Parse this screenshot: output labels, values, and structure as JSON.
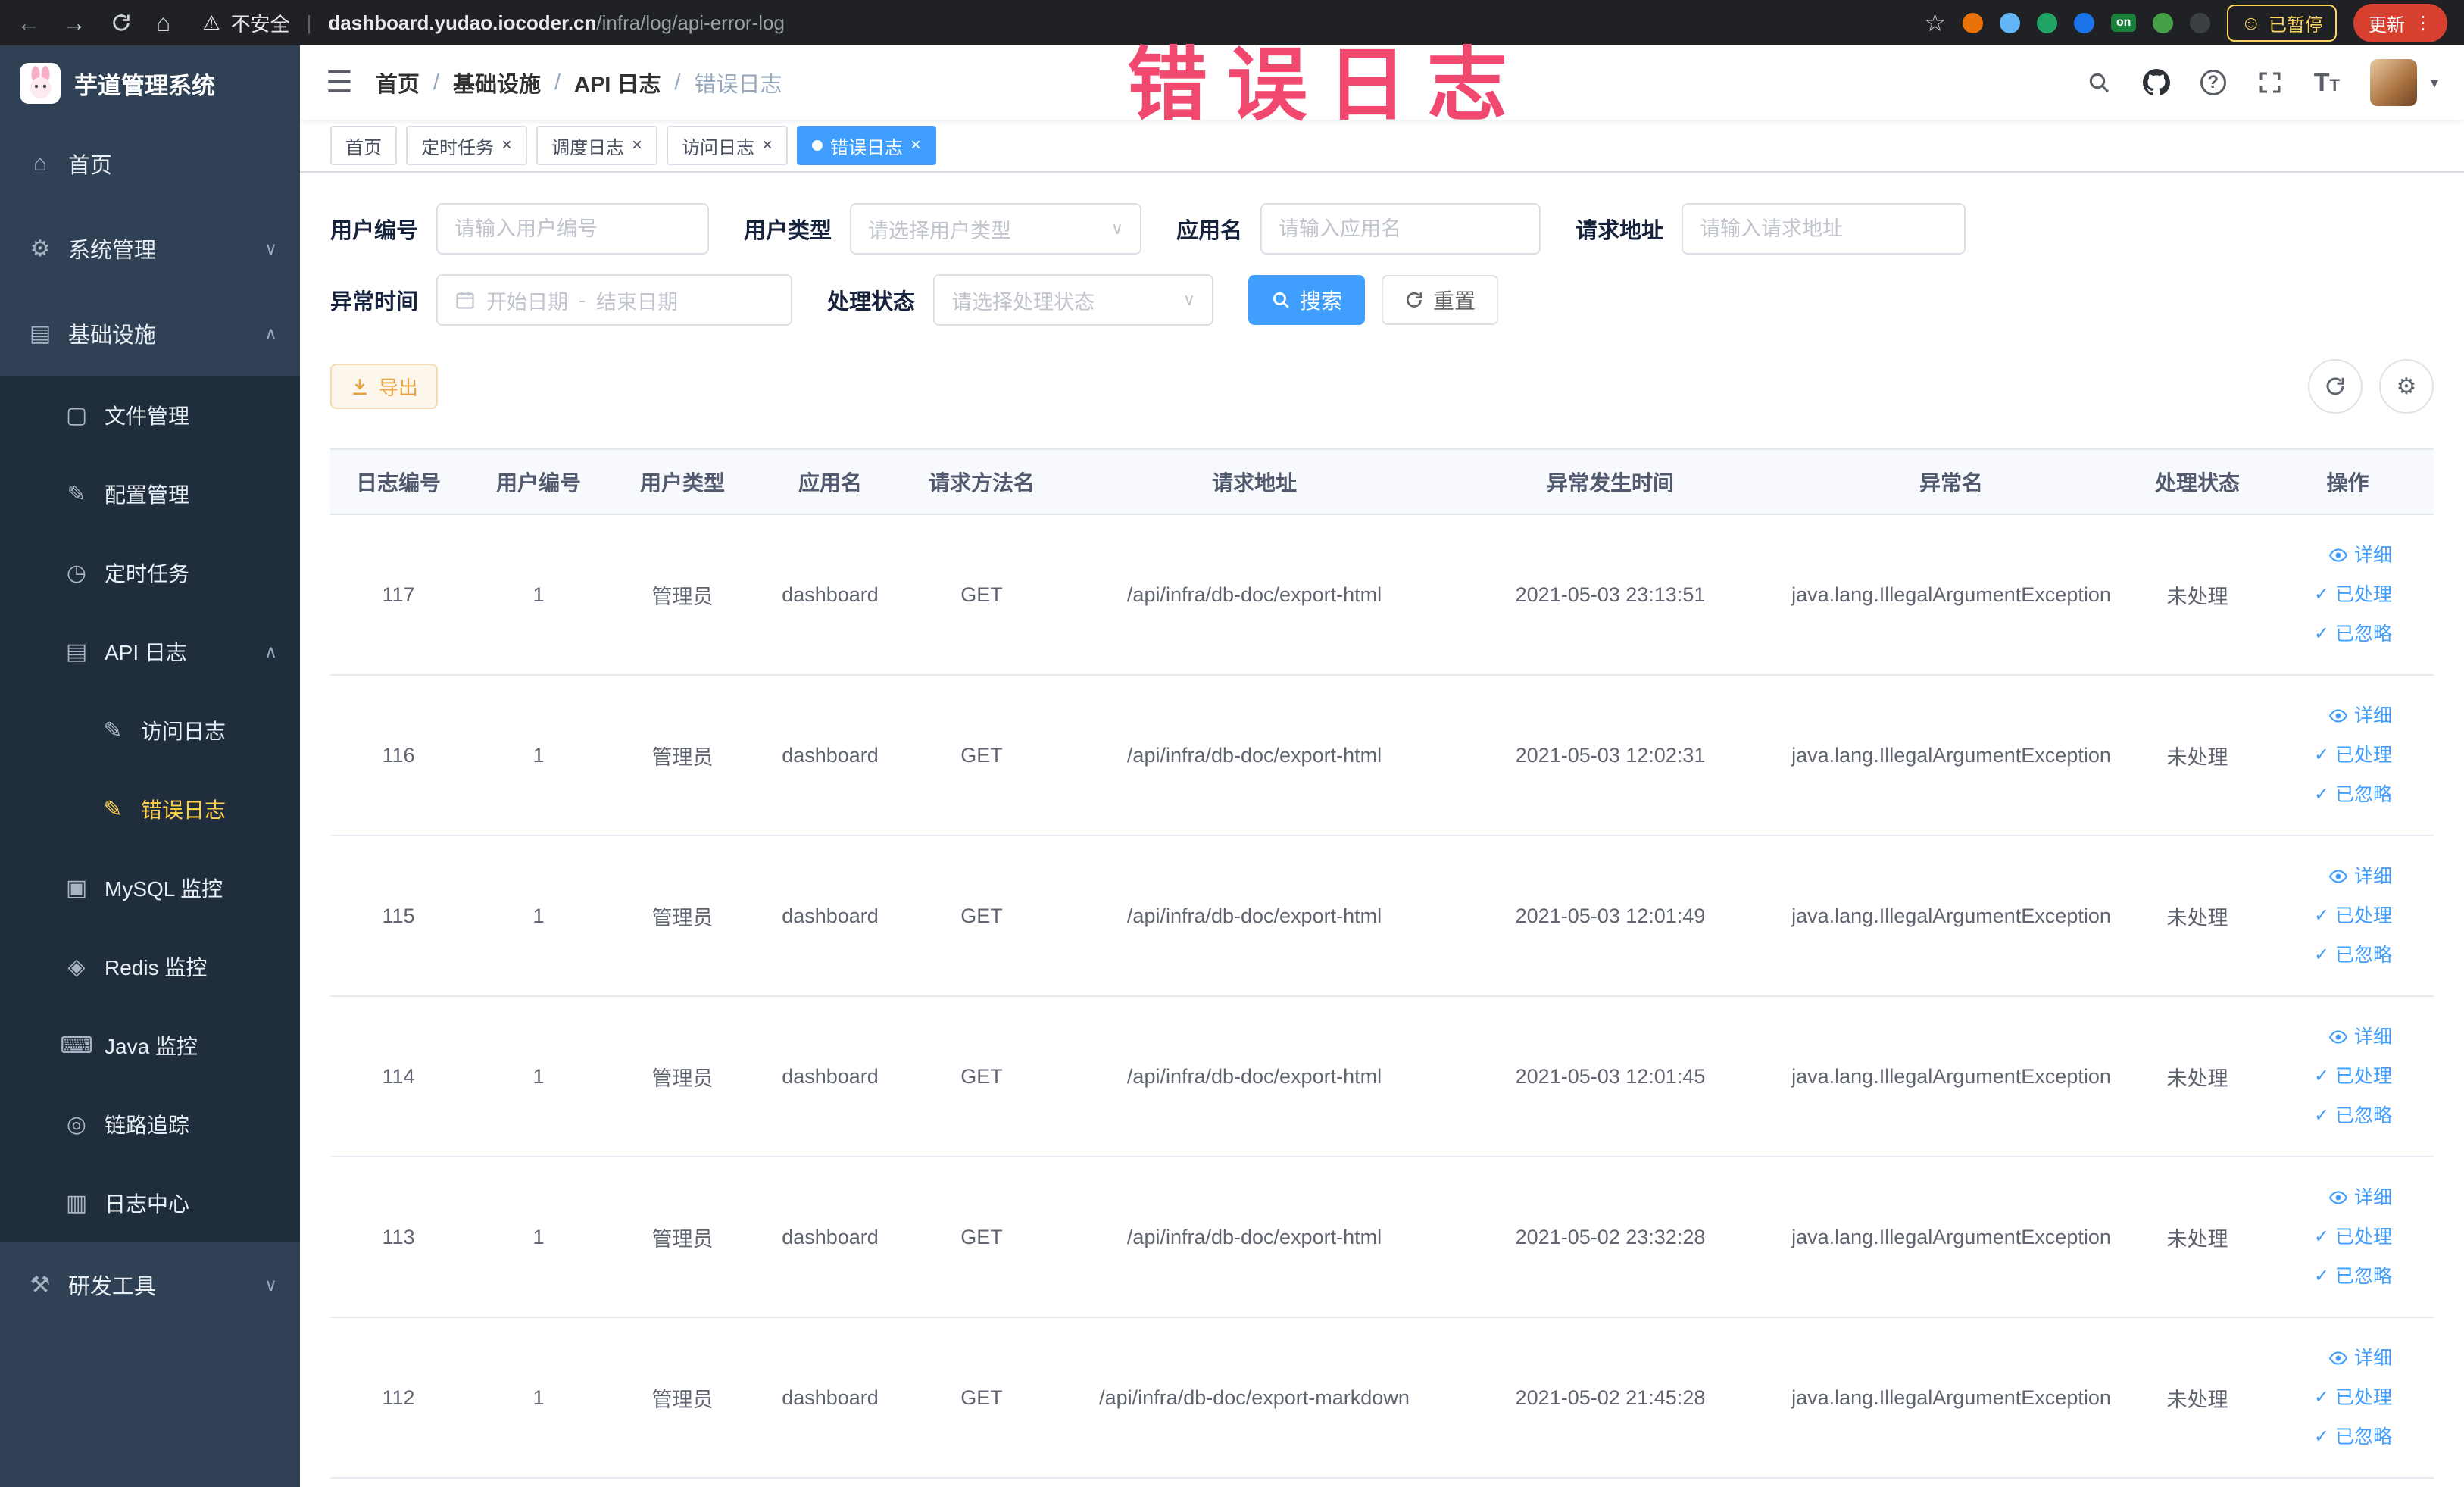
{
  "browser": {
    "security_label": "不安全",
    "url_domain": "dashboard.yudao.iocoder.cn",
    "url_path": "/infra/log/api-error-log",
    "ext_badge_on": "on",
    "paused_badge": "已暂停",
    "update_button": "更新"
  },
  "annotation": {
    "text": "错误日志"
  },
  "sidebar": {
    "logo_title": "芋道管理系统",
    "items": [
      {
        "label": "首页",
        "icon": "home-icon",
        "level": 1
      },
      {
        "label": "系统管理",
        "icon": "gear-icon",
        "level": 1,
        "chevron": "down"
      },
      {
        "label": "基础设施",
        "icon": "infra-icon",
        "level": 1,
        "chevron": "up"
      },
      {
        "label": "文件管理",
        "icon": "file-icon",
        "level": 2
      },
      {
        "label": "配置管理",
        "icon": "config-icon",
        "level": 2
      },
      {
        "label": "定时任务",
        "icon": "timer-icon",
        "level": 2
      },
      {
        "label": "API 日志",
        "icon": "api-log-icon",
        "level": 2,
        "chevron": "up"
      },
      {
        "label": "访问日志",
        "icon": "access-log-icon",
        "level": 3
      },
      {
        "label": "错误日志",
        "icon": "error-log-icon",
        "level": 3,
        "active": true
      },
      {
        "label": "MySQL 监控",
        "icon": "mysql-icon",
        "level": 2
      },
      {
        "label": "Redis 监控",
        "icon": "redis-icon",
        "level": 2
      },
      {
        "label": "Java 监控",
        "icon": "java-icon",
        "level": 2
      },
      {
        "label": "链路追踪",
        "icon": "trace-icon",
        "level": 2
      },
      {
        "label": "日志中心",
        "icon": "log-center-icon",
        "level": 2
      },
      {
        "label": "研发工具",
        "icon": "tools-icon",
        "level": 1,
        "chevron": "down"
      }
    ]
  },
  "header": {
    "breadcrumb": [
      "首页",
      "基础设施",
      "API 日志",
      "错误日志"
    ]
  },
  "tabs": [
    {
      "label": "首页",
      "closable": false,
      "active": false
    },
    {
      "label": "定时任务",
      "closable": true,
      "active": false
    },
    {
      "label": "调度日志",
      "closable": true,
      "active": false
    },
    {
      "label": "访问日志",
      "closable": true,
      "active": false
    },
    {
      "label": "错误日志",
      "closable": true,
      "active": true
    }
  ],
  "filters": {
    "user_id_label": "用户编号",
    "user_id_placeholder": "请输入用户编号",
    "user_type_label": "用户类型",
    "user_type_placeholder": "请选择用户类型",
    "app_name_label": "应用名",
    "app_name_placeholder": "请输入应用名",
    "request_url_label": "请求地址",
    "request_url_placeholder": "请输入请求地址",
    "exception_time_label": "异常时间",
    "start_date_placeholder": "开始日期",
    "end_date_placeholder": "结束日期",
    "range_separator": "-",
    "process_status_label": "处理状态",
    "process_status_placeholder": "请选择处理状态",
    "search_button": "搜索",
    "reset_button": "重置"
  },
  "toolbar": {
    "export_label": "导出"
  },
  "table": {
    "columns": [
      "日志编号",
      "用户编号",
      "用户类型",
      "应用名",
      "请求方法名",
      "请求地址",
      "异常发生时间",
      "异常名",
      "处理状态",
      "操作"
    ],
    "action_labels": {
      "detail": "详细",
      "processed": "已处理",
      "ignored": "已忽略"
    },
    "rows": [
      {
        "id": "117",
        "user_id": "1",
        "user_type": "管理员",
        "app": "dashboard",
        "method": "GET",
        "url": "/api/infra/db-doc/export-html",
        "time": "2021-05-03 23:13:51",
        "exception": "java.lang.IllegalArgumentException",
        "status": "未处理"
      },
      {
        "id": "116",
        "user_id": "1",
        "user_type": "管理员",
        "app": "dashboard",
        "method": "GET",
        "url": "/api/infra/db-doc/export-html",
        "time": "2021-05-03 12:02:31",
        "exception": "java.lang.IllegalArgumentException",
        "status": "未处理"
      },
      {
        "id": "115",
        "user_id": "1",
        "user_type": "管理员",
        "app": "dashboard",
        "method": "GET",
        "url": "/api/infra/db-doc/export-html",
        "time": "2021-05-03 12:01:49",
        "exception": "java.lang.IllegalArgumentException",
        "status": "未处理"
      },
      {
        "id": "114",
        "user_id": "1",
        "user_type": "管理员",
        "app": "dashboard",
        "method": "GET",
        "url": "/api/infra/db-doc/export-html",
        "time": "2021-05-03 12:01:45",
        "exception": "java.lang.IllegalArgumentException",
        "status": "未处理"
      },
      {
        "id": "113",
        "user_id": "1",
        "user_type": "管理员",
        "app": "dashboard",
        "method": "GET",
        "url": "/api/infra/db-doc/export-html",
        "time": "2021-05-02 23:32:28",
        "exception": "java.lang.IllegalArgumentException",
        "status": "未处理"
      },
      {
        "id": "112",
        "user_id": "1",
        "user_type": "管理员",
        "app": "dashboard",
        "method": "GET",
        "url": "/api/infra/db-doc/export-markdown",
        "time": "2021-05-02 21:45:28",
        "exception": "java.lang.IllegalArgumentException",
        "status": "未处理"
      }
    ]
  }
}
